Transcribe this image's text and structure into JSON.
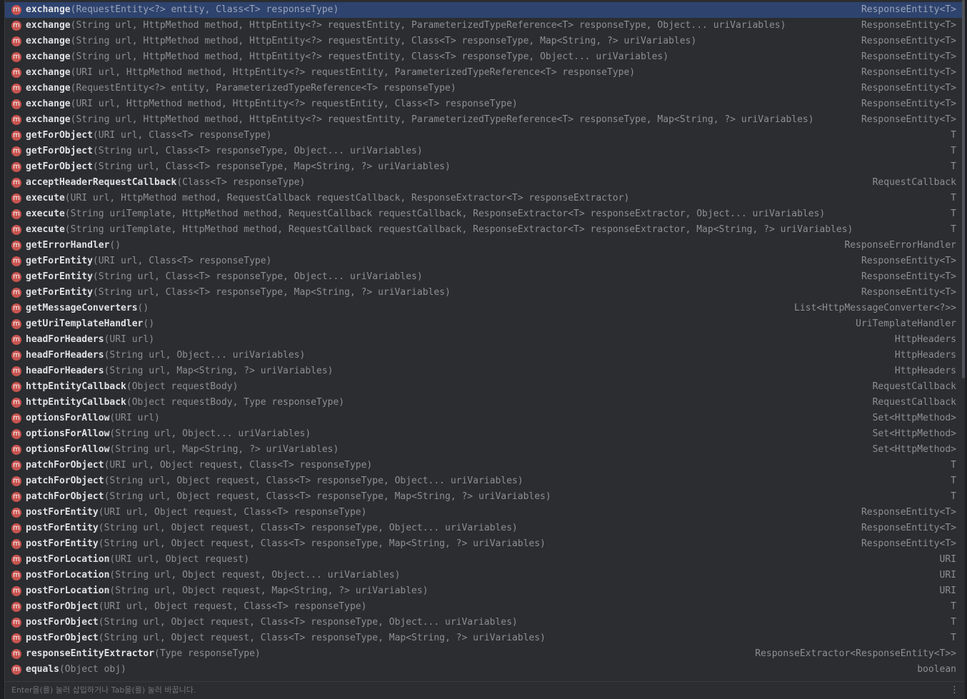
{
  "completion": {
    "icon_letter": "m",
    "icon_color": "#c75450",
    "selected_index": 0,
    "items": [
      {
        "name": "exchange",
        "params": "(RequestEntity<?> entity, Class<T> responseType)",
        "ret": "ResponseEntity<T>"
      },
      {
        "name": "exchange",
        "params": "(String url, HttpMethod method, HttpEntity<?> requestEntity, ParameterizedTypeReference<T> responseType, Object... uriVariables)",
        "ret": "ResponseEntity<T>"
      },
      {
        "name": "exchange",
        "params": "(String url, HttpMethod method, HttpEntity<?> requestEntity, Class<T> responseType, Map<String, ?> uriVariables)",
        "ret": "ResponseEntity<T>"
      },
      {
        "name": "exchange",
        "params": "(String url, HttpMethod method, HttpEntity<?> requestEntity, Class<T> responseType, Object... uriVariables)",
        "ret": "ResponseEntity<T>"
      },
      {
        "name": "exchange",
        "params": "(URI url, HttpMethod method, HttpEntity<?> requestEntity, ParameterizedTypeReference<T> responseType)",
        "ret": "ResponseEntity<T>"
      },
      {
        "name": "exchange",
        "params": "(RequestEntity<?> entity, ParameterizedTypeReference<T> responseType)",
        "ret": "ResponseEntity<T>"
      },
      {
        "name": "exchange",
        "params": "(URI url, HttpMethod method, HttpEntity<?> requestEntity, Class<T> responseType)",
        "ret": "ResponseEntity<T>"
      },
      {
        "name": "exchange",
        "params": "(String url, HttpMethod method, HttpEntity<?> requestEntity, ParameterizedTypeReference<T> responseType, Map<String, ?> uriVariables)",
        "ret": "ResponseEntity<T>"
      },
      {
        "name": "getForObject",
        "params": "(URI url, Class<T> responseType)",
        "ret": "T"
      },
      {
        "name": "getForObject",
        "params": "(String url, Class<T> responseType, Object... uriVariables)",
        "ret": "T"
      },
      {
        "name": "getForObject",
        "params": "(String url, Class<T> responseType, Map<String, ?> uriVariables)",
        "ret": "T"
      },
      {
        "name": "acceptHeaderRequestCallback",
        "params": "(Class<T> responseType)",
        "ret": "RequestCallback"
      },
      {
        "name": "execute",
        "params": "(URI url, HttpMethod method, RequestCallback requestCallback, ResponseExtractor<T> responseExtractor)",
        "ret": "T"
      },
      {
        "name": "execute",
        "params": "(String uriTemplate, HttpMethod method, RequestCallback requestCallback, ResponseExtractor<T> responseExtractor, Object... uriVariables)",
        "ret": "T"
      },
      {
        "name": "execute",
        "params": "(String uriTemplate, HttpMethod method, RequestCallback requestCallback, ResponseExtractor<T> responseExtractor, Map<String, ?> uriVariables)",
        "ret": "T"
      },
      {
        "name": "getErrorHandler",
        "params": "()",
        "ret": "ResponseErrorHandler"
      },
      {
        "name": "getForEntity",
        "params": "(URI url, Class<T> responseType)",
        "ret": "ResponseEntity<T>"
      },
      {
        "name": "getForEntity",
        "params": "(String url, Class<T> responseType, Object... uriVariables)",
        "ret": "ResponseEntity<T>"
      },
      {
        "name": "getForEntity",
        "params": "(String url, Class<T> responseType, Map<String, ?> uriVariables)",
        "ret": "ResponseEntity<T>"
      },
      {
        "name": "getMessageConverters",
        "params": "()",
        "ret": "List<HttpMessageConverter<?>>"
      },
      {
        "name": "getUriTemplateHandler",
        "params": "()",
        "ret": "UriTemplateHandler"
      },
      {
        "name": "headForHeaders",
        "params": "(URI url)",
        "ret": "HttpHeaders"
      },
      {
        "name": "headForHeaders",
        "params": "(String url, Object... uriVariables)",
        "ret": "HttpHeaders"
      },
      {
        "name": "headForHeaders",
        "params": "(String url, Map<String, ?> uriVariables)",
        "ret": "HttpHeaders"
      },
      {
        "name": "httpEntityCallback",
        "params": "(Object requestBody)",
        "ret": "RequestCallback"
      },
      {
        "name": "httpEntityCallback",
        "params": "(Object requestBody, Type responseType)",
        "ret": "RequestCallback"
      },
      {
        "name": "optionsForAllow",
        "params": "(URI url)",
        "ret": "Set<HttpMethod>"
      },
      {
        "name": "optionsForAllow",
        "params": "(String url, Object... uriVariables)",
        "ret": "Set<HttpMethod>"
      },
      {
        "name": "optionsForAllow",
        "params": "(String url, Map<String, ?> uriVariables)",
        "ret": "Set<HttpMethod>"
      },
      {
        "name": "patchForObject",
        "params": "(URI url, Object request, Class<T> responseType)",
        "ret": "T"
      },
      {
        "name": "patchForObject",
        "params": "(String url, Object request, Class<T> responseType, Object... uriVariables)",
        "ret": "T"
      },
      {
        "name": "patchForObject",
        "params": "(String url, Object request, Class<T> responseType, Map<String, ?> uriVariables)",
        "ret": "T"
      },
      {
        "name": "postForEntity",
        "params": "(URI url, Object request, Class<T> responseType)",
        "ret": "ResponseEntity<T>"
      },
      {
        "name": "postForEntity",
        "params": "(String url, Object request, Class<T> responseType, Object... uriVariables)",
        "ret": "ResponseEntity<T>"
      },
      {
        "name": "postForEntity",
        "params": "(String url, Object request, Class<T> responseType, Map<String, ?> uriVariables)",
        "ret": "ResponseEntity<T>"
      },
      {
        "name": "postForLocation",
        "params": "(URI url, Object request)",
        "ret": "URI"
      },
      {
        "name": "postForLocation",
        "params": "(String url, Object request, Object... uriVariables)",
        "ret": "URI"
      },
      {
        "name": "postForLocation",
        "params": "(String url, Object request, Map<String, ?> uriVariables)",
        "ret": "URI"
      },
      {
        "name": "postForObject",
        "params": "(URI url, Object request, Class<T> responseType)",
        "ret": "T"
      },
      {
        "name": "postForObject",
        "params": "(String url, Object request, Class<T> responseType, Object... uriVariables)",
        "ret": "T"
      },
      {
        "name": "postForObject",
        "params": "(String url, Object request, Class<T> responseType, Map<String, ?> uriVariables)",
        "ret": "T"
      },
      {
        "name": "responseEntityExtractor",
        "params": "(Type responseType)",
        "ret": "ResponseExtractor<ResponseEntity<T>>"
      },
      {
        "name": "equals",
        "params": "(Object obj)",
        "ret": "boolean"
      }
    ]
  },
  "footer": {
    "hint": "Enter을(를) 눌러 삽입하거나 Tab을(를) 눌러 바꿉니다.",
    "more_icon": "⋮"
  }
}
